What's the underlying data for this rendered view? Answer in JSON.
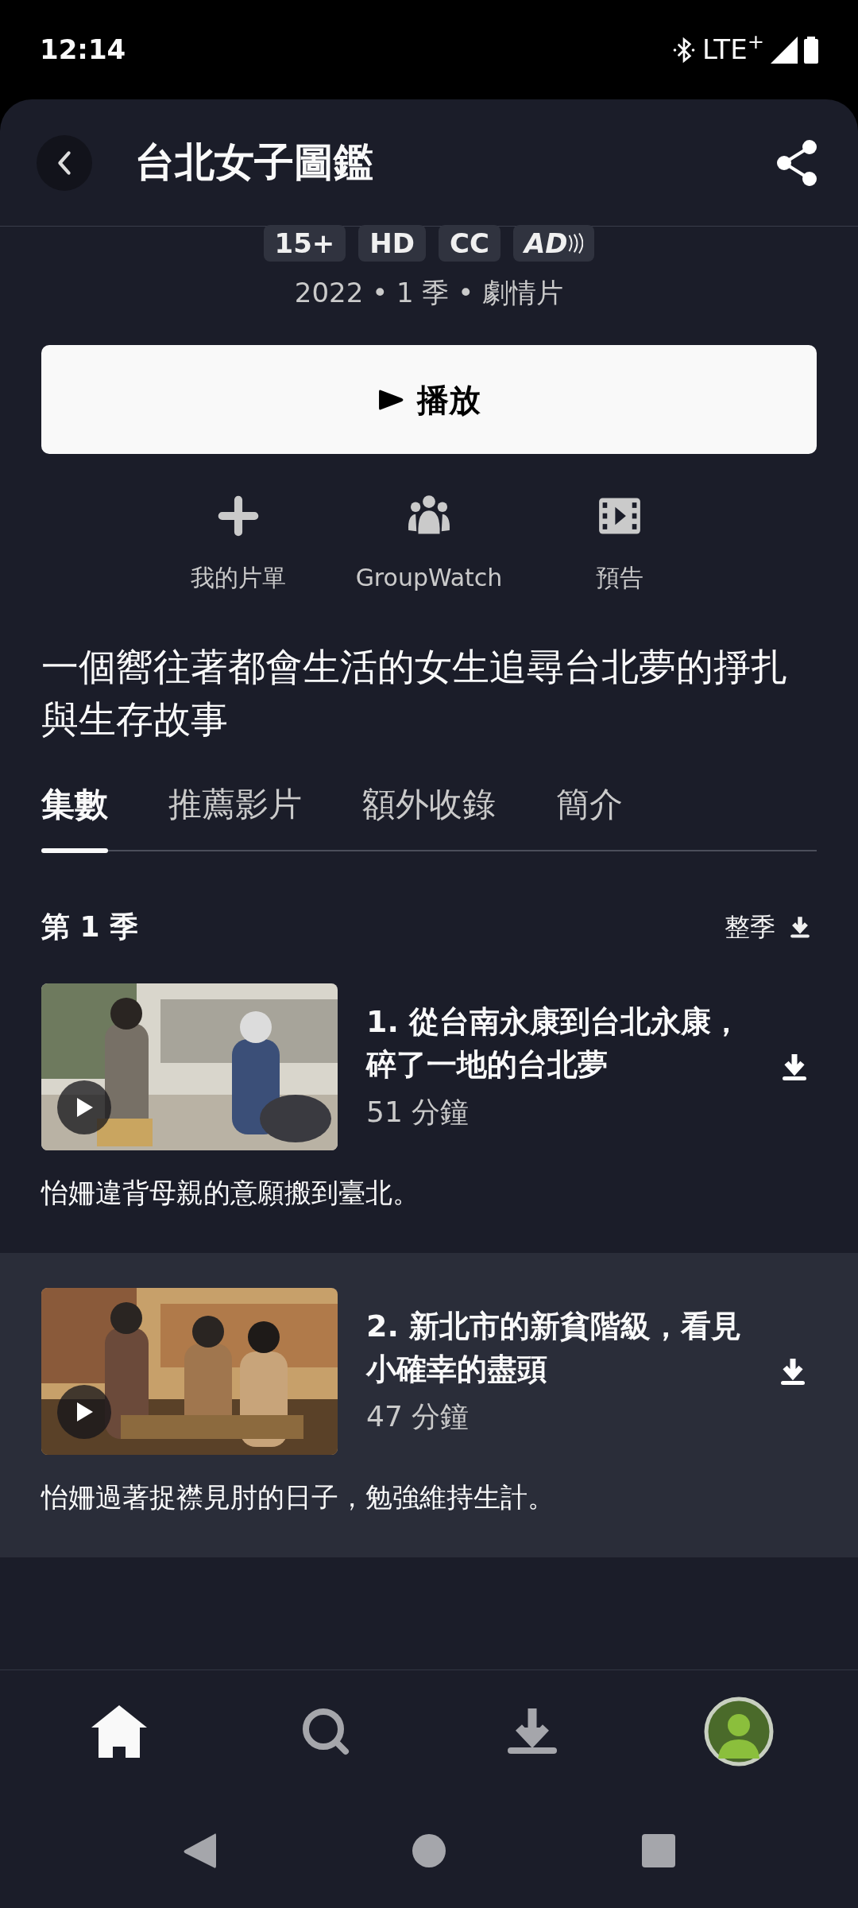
{
  "status_bar": {
    "time": "12:14",
    "network": "LTE",
    "network_sup": "+"
  },
  "header": {
    "title": "台北女子圖鑑"
  },
  "badges": [
    {
      "label": "15+",
      "kind": "text"
    },
    {
      "label": "HD",
      "kind": "text"
    },
    {
      "label": "CC",
      "kind": "text"
    },
    {
      "label": "AD",
      "kind": "audio"
    }
  ],
  "meta": "2022 • 1 季 • 劇情片",
  "play_button": {
    "label": "播放"
  },
  "actions": [
    {
      "label": "我的片單",
      "kind": "add"
    },
    {
      "label": "GroupWatch",
      "kind": "group"
    },
    {
      "label": "預告",
      "kind": "trailer"
    }
  ],
  "tagline": "一個嚮往著都會生活的女生追尋台北夢的掙扎與生存故事",
  "tabs": [
    {
      "label": "集數",
      "selected": true
    },
    {
      "label": "推薦影片",
      "selected": false
    },
    {
      "label": "額外收錄",
      "selected": false
    },
    {
      "label": "簡介",
      "selected": false
    }
  ],
  "season": {
    "title": "第 1 季",
    "download_label": "整季"
  },
  "episodes": [
    {
      "title": "1. 從台南永康到台北永康，碎了一地的台北夢",
      "duration": "51 分鐘",
      "description": "怡姍違背母親的意願搬到臺北。",
      "highlighted": false
    },
    {
      "title": "2. 新北市的新貧階級，看見小確幸的盡頭",
      "duration": "47 分鐘",
      "description": "怡姍過著捉襟見肘的日子，勉強維持生計。",
      "highlighted": true
    }
  ],
  "bottom_nav": [
    {
      "kind": "home",
      "selected": true
    },
    {
      "kind": "search",
      "selected": false
    },
    {
      "kind": "downloads",
      "selected": false
    },
    {
      "kind": "profile",
      "selected": false
    }
  ]
}
